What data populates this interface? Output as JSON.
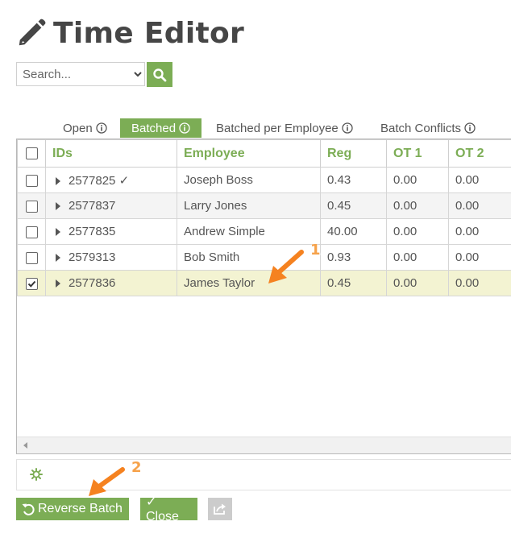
{
  "page": {
    "title": "Time Editor"
  },
  "search": {
    "placeholder": "Search..."
  },
  "tabs": [
    {
      "label": "Open",
      "active": false
    },
    {
      "label": "Batched",
      "active": true
    },
    {
      "label": "Batched per Employee",
      "active": false
    },
    {
      "label": "Batch Conflicts",
      "active": false
    }
  ],
  "table": {
    "columns": [
      "IDs",
      "Employee",
      "Reg",
      "OT 1",
      "OT 2"
    ],
    "rows": [
      {
        "checked": false,
        "id": "2577825 ✓",
        "employee": "Joseph Boss",
        "reg": "0.43",
        "ot1": "0.00",
        "ot2": "0.00"
      },
      {
        "checked": false,
        "id": "2577837",
        "employee": "Larry Jones",
        "reg": "0.45",
        "ot1": "0.00",
        "ot2": "0.00"
      },
      {
        "checked": false,
        "id": "2577835",
        "employee": "Andrew Simple",
        "reg": "40.00",
        "ot1": "0.00",
        "ot2": "0.00"
      },
      {
        "checked": false,
        "id": "2579313",
        "employee": "Bob Smith",
        "reg": "0.93",
        "ot1": "0.00",
        "ot2": "0.00"
      },
      {
        "checked": true,
        "id": "2577836",
        "employee": "James Taylor",
        "reg": "0.45",
        "ot1": "0.00",
        "ot2": "0.00"
      }
    ]
  },
  "buttons": {
    "reverse_batch": "Reverse Batch",
    "close": "✓ Close"
  },
  "annotations": {
    "step1": "1",
    "step2": "2"
  },
  "colors": {
    "accent": "#7cad55",
    "annotation": "#f58220",
    "selected_row": "#f3f3d2"
  },
  "icons": {
    "title": "pencil-icon",
    "search": "search-icon",
    "dropdown": "chevron-down-icon",
    "info": "info-icon",
    "expand": "caret-right-icon",
    "settings": "gear-icon",
    "reverse": "undo-icon",
    "export": "share-icon"
  }
}
